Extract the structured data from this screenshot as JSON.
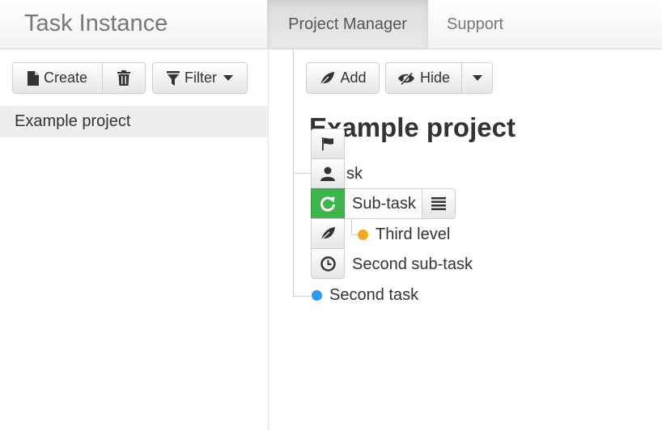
{
  "navbar": {
    "brand": "Task Instance",
    "tabs": [
      {
        "label": "Project Manager",
        "active": true
      },
      {
        "label": "Support",
        "active": false
      }
    ]
  },
  "sidebar": {
    "toolbar": {
      "create_label": "Create",
      "delete_icon": "trash-icon",
      "filter_label": "Filter"
    },
    "projects": [
      {
        "label": "Example project",
        "selected": true
      }
    ]
  },
  "main": {
    "toolbar": {
      "add_label": "Add",
      "hide_label": "Hide"
    },
    "title": "Example project",
    "tasks": [
      {
        "label": "sk",
        "dot_color": null
      },
      {
        "label": "Sub-task",
        "status_color": "#3cb54a",
        "icon": "refresh-icon"
      },
      {
        "label": "Third level",
        "dot_color": "#f5a623"
      },
      {
        "label": "Second sub-task",
        "dot_color": null
      },
      {
        "label": "Second task",
        "dot_color": "#2b9cf2"
      }
    ],
    "side_icons": [
      "flag-icon",
      "user-icon",
      "refresh-icon",
      "leaf-icon",
      "clock-icon"
    ]
  },
  "colors": {
    "accent_green": "#3cb54a",
    "dot_orange": "#f5a623",
    "dot_blue": "#2b9cf2"
  }
}
